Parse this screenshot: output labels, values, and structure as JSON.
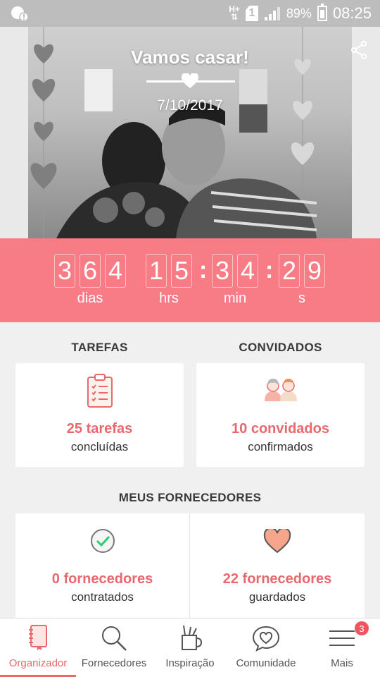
{
  "statusbar": {
    "network": "H+",
    "sim": "1",
    "battery": "89%",
    "time": "08:25"
  },
  "hero": {
    "title": "Vamos casar!",
    "date": "7/10/2017"
  },
  "countdown": {
    "days": [
      "3",
      "6",
      "4"
    ],
    "hours": [
      "1",
      "5"
    ],
    "minutes": [
      "3",
      "4"
    ],
    "seconds": [
      "2",
      "9"
    ],
    "separator": ":",
    "days_label": "dias",
    "hours_label": "hrs",
    "minutes_label": "min",
    "seconds_label": "s"
  },
  "tasks": {
    "title": "TAREFAS",
    "count": "25 tarefas",
    "sub": "concluídas",
    "icon": "clipboard-checklist-icon"
  },
  "guests": {
    "title": "CONVIDADOS",
    "count": "10 convidados",
    "sub": "confirmados",
    "icon": "couple-icon"
  },
  "vendors": {
    "title": "MEUS FORNECEDORES",
    "hired_count": "0 fornecedores",
    "hired_sub": "contratados",
    "saved_count": "22 fornecedores",
    "saved_sub": "guardados"
  },
  "nav": {
    "items": [
      {
        "label": "Organizador",
        "icon": "notebook-icon",
        "active": true
      },
      {
        "label": "Fornecedores",
        "icon": "search-icon"
      },
      {
        "label": "Inspiração",
        "icon": "inspiration-icon"
      },
      {
        "label": "Comunidade",
        "icon": "chat-heart-icon"
      },
      {
        "label": "Mais",
        "icon": "menu-icon"
      }
    ],
    "more_badge": "3"
  },
  "colors": {
    "accent": "#e8696d",
    "countdown_bg": "#f87c86",
    "badge": "#f0545f"
  }
}
